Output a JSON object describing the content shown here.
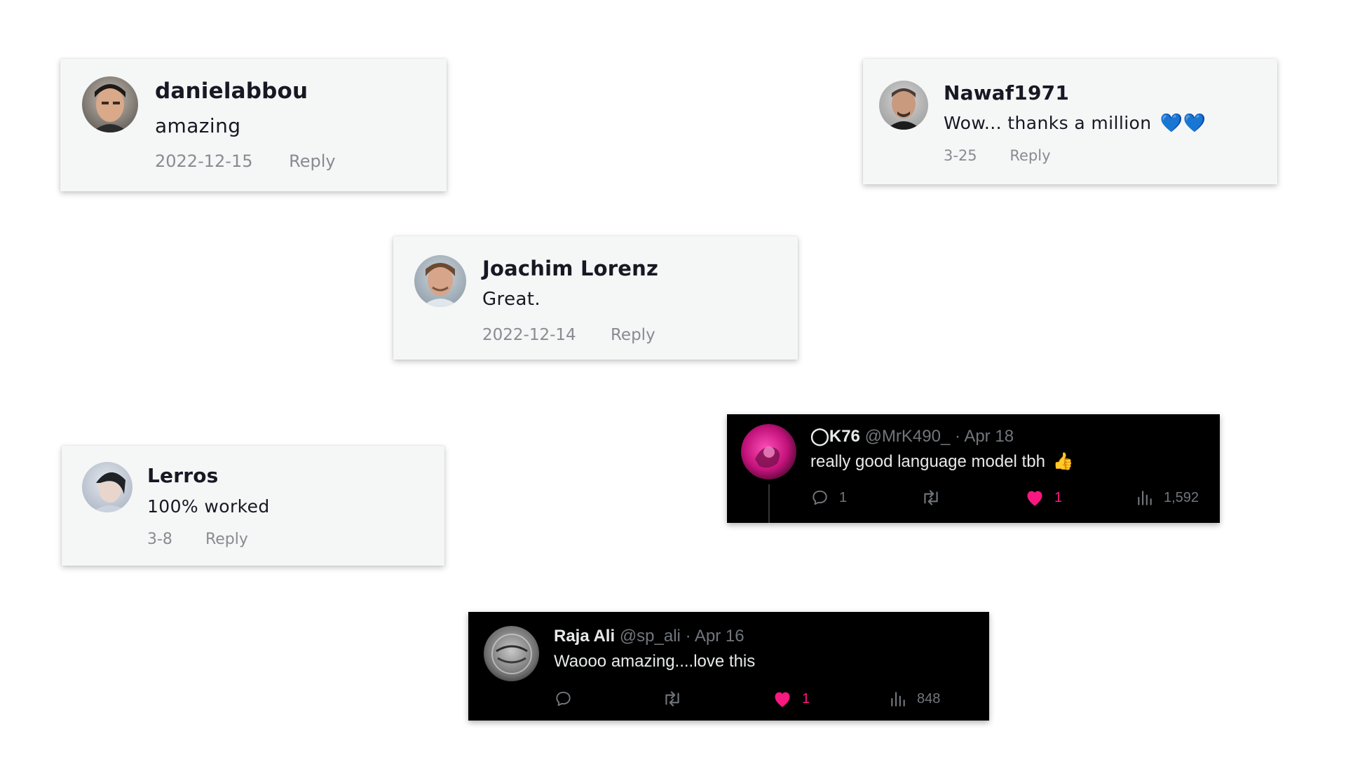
{
  "comments": [
    {
      "username": "danielabbou",
      "text": "amazing",
      "date": "2022-12-15",
      "reply": "Reply",
      "avatar": "avatar-photo"
    },
    {
      "username": "Nawaf1971",
      "text": "Wow... thanks a million",
      "emoji": "💙💙",
      "date": "3-25",
      "reply": "Reply",
      "avatar": "avatar-photo"
    },
    {
      "username": "Joachim Lorenz",
      "text": "Great.",
      "date": "2022-12-14",
      "reply": "Reply",
      "avatar": "avatar-photo"
    },
    {
      "username": "Lerros",
      "text": "100% worked",
      "date": "3-8",
      "reply": "Reply",
      "avatar": "avatar-photo"
    }
  ],
  "posts": [
    {
      "display_name": "◯K76",
      "handle": "@MrK490_",
      "separator": "·",
      "date": "Apr 18",
      "text": "really good language model tbh",
      "emoji": "👍",
      "replies": "1",
      "likes": "1",
      "views": "1,592",
      "liked": true,
      "avatar": "avatar-photo"
    },
    {
      "display_name": "Raja Ali",
      "handle": "@sp_ali",
      "separator": "·",
      "date": "Apr 16",
      "text": "Waooo amazing....love this",
      "likes": "1",
      "views": "848",
      "liked": true,
      "avatar": "avatar-photo"
    }
  ],
  "icons": {
    "reply": "speech-bubble-icon",
    "repost": "repost-arrows-icon",
    "like": "heart-icon",
    "views": "bar-chart-icon"
  },
  "colors": {
    "light_card_bg": "#f5f6f6",
    "light_text": "#161823",
    "light_meta": "#8a8b91",
    "dark_card_bg": "#000000",
    "dark_text": "#e7e9ea",
    "dark_meta": "#71767b",
    "like_pink": "#f91880"
  }
}
